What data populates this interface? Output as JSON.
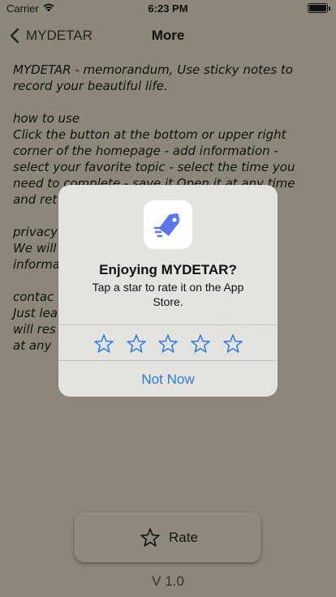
{
  "status_bar": {
    "carrier": "Carrier",
    "time": "6:23 PM"
  },
  "nav": {
    "back_label": "MYDETAR",
    "title": "More"
  },
  "content": {
    "paragraph1": [
      "MYDETAR - memorandum, Use sticky notes to",
      "record your beautiful life."
    ],
    "paragraph2": [
      "how to use",
      "Click the button at the bottom or upper right",
      "corner of the homepage - add information -",
      "select your favorite topic - select the time you",
      "need to complete - save it Open it at any time",
      "and ret"
    ],
    "paragraph3": [
      "privacy",
      "We will",
      "informa                                          ndbox."
    ],
    "paragraph4": [
      "contac",
      "Just lea                                          d I",
      "will res                                          estions",
      "at any"
    ]
  },
  "dialog": {
    "title": "Enjoying MYDETAR?",
    "message": "Tap a star to rate it on the App Store.",
    "star_count": 5,
    "dismiss_label": "Not Now",
    "accent_color": "#2a7ae4"
  },
  "footer": {
    "rate_label": "Rate",
    "version": "V 1.0"
  },
  "colors": {
    "background": "#8c8778",
    "dialog_background": "#e8e6e2",
    "app_icon_blue": "#5a76e8"
  }
}
